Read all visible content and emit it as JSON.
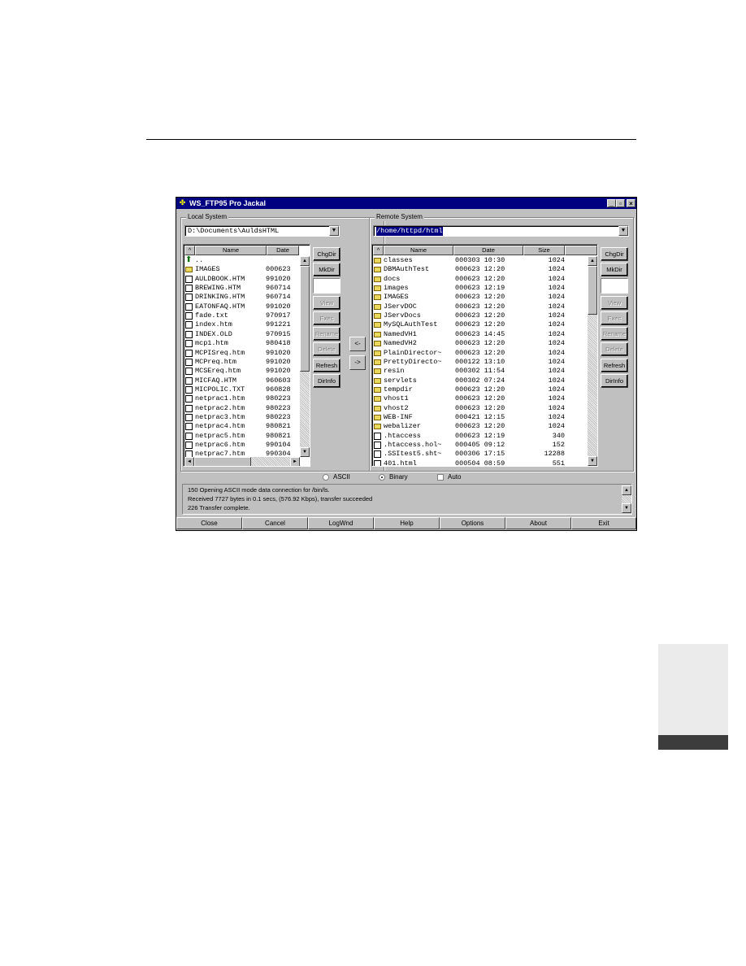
{
  "window": {
    "title": "WS_FTP95 Pro Jackal",
    "controls": [
      "_",
      "▫",
      "×"
    ]
  },
  "local": {
    "label": "Local System",
    "path": "D:\\Documents\\AuldsHTML",
    "headers": {
      "sort": "^",
      "name": "Name",
      "date": "Date"
    },
    "files": [
      {
        "name": "..",
        "date": "",
        "icon": "up-arrow-icon"
      },
      {
        "name": "IMAGES",
        "date": "000623",
        "icon": "folder-icon"
      },
      {
        "name": "AULDBOOK.HTM",
        "date": "991020",
        "icon": "file-icon"
      },
      {
        "name": "BREWING.HTM",
        "date": "960714",
        "icon": "file-icon"
      },
      {
        "name": "DRINKING.HTM",
        "date": "960714",
        "icon": "file-icon"
      },
      {
        "name": "EATONFAQ.HTM",
        "date": "991020",
        "icon": "file-icon"
      },
      {
        "name": "fade.txt",
        "date": "970917",
        "icon": "file-icon"
      },
      {
        "name": "index.htm",
        "date": "991221",
        "icon": "file-icon"
      },
      {
        "name": "INDEX.OLD",
        "date": "970915",
        "icon": "file-icon"
      },
      {
        "name": "mcp1.htm",
        "date": "980418",
        "icon": "file-icon"
      },
      {
        "name": "MCPISreq.htm",
        "date": "991020",
        "icon": "file-icon"
      },
      {
        "name": "MCPreq.htm",
        "date": "991020",
        "icon": "file-icon"
      },
      {
        "name": "MCSEreq.htm",
        "date": "991020",
        "icon": "file-icon"
      },
      {
        "name": "MICFAQ.HTM",
        "date": "960603",
        "icon": "file-icon"
      },
      {
        "name": "MICPOLIC.TXT",
        "date": "960828",
        "icon": "file-icon"
      },
      {
        "name": "netprac1.htm",
        "date": "980223",
        "icon": "file-icon"
      },
      {
        "name": "netprac2.htm",
        "date": "980223",
        "icon": "file-icon"
      },
      {
        "name": "netprac3.htm",
        "date": "980223",
        "icon": "file-icon"
      },
      {
        "name": "netprac4.htm",
        "date": "980821",
        "icon": "file-icon"
      },
      {
        "name": "netprac5.htm",
        "date": "980821",
        "icon": "file-icon"
      },
      {
        "name": "netprac6.htm",
        "date": "990104",
        "icon": "file-icon"
      },
      {
        "name": "netprac7.htm",
        "date": "990304",
        "icon": "file-icon"
      }
    ],
    "buttons": {
      "chgdir": "ChgDir",
      "mkdir": "MkDir",
      "view": "View",
      "exec": "Exec",
      "rename": "Rename",
      "delete": "Delete",
      "refresh": "Refresh",
      "dirinfo": "DirInfo"
    }
  },
  "remote": {
    "label": "Remote System",
    "path": "/home/httpd/html",
    "headers": {
      "sort": "^",
      "name": "Name",
      "date": "Date",
      "size": "Size"
    },
    "files": [
      {
        "name": "classes",
        "date": "000303 10:30",
        "size": "1024",
        "icon": "folder-icon"
      },
      {
        "name": "DBMAuthTest",
        "date": "000623 12:20",
        "size": "1024",
        "icon": "folder-icon"
      },
      {
        "name": "docs",
        "date": "000623 12:20",
        "size": "1024",
        "icon": "folder-icon"
      },
      {
        "name": "images",
        "date": "000623 12:19",
        "size": "1024",
        "icon": "folder-icon"
      },
      {
        "name": "IMAGES",
        "date": "000623 12:20",
        "size": "1024",
        "icon": "folder-icon"
      },
      {
        "name": "JServDOC",
        "date": "000623 12:20",
        "size": "1024",
        "icon": "folder-icon"
      },
      {
        "name": "JServDocs",
        "date": "000623 12:20",
        "size": "1024",
        "icon": "folder-icon"
      },
      {
        "name": "MySQLAuthTest",
        "date": "000623 12:20",
        "size": "1024",
        "icon": "folder-icon"
      },
      {
        "name": "NamedVH1",
        "date": "000623 14:45",
        "size": "1024",
        "icon": "folder-icon"
      },
      {
        "name": "NamedVH2",
        "date": "000623 12:20",
        "size": "1024",
        "icon": "folder-icon"
      },
      {
        "name": "PlainDirector~",
        "date": "000623 12:20",
        "size": "1024",
        "icon": "folder-icon"
      },
      {
        "name": "PrettyDirecto~",
        "date": "000122 13:10",
        "size": "1024",
        "icon": "folder-icon"
      },
      {
        "name": "resin",
        "date": "000302 11:54",
        "size": "1024",
        "icon": "folder-icon"
      },
      {
        "name": "servlets",
        "date": "000302 07:24",
        "size": "1024",
        "icon": "folder-icon"
      },
      {
        "name": "tempdir",
        "date": "000623 12:20",
        "size": "1024",
        "icon": "folder-icon"
      },
      {
        "name": "vhost1",
        "date": "000623 12:20",
        "size": "1024",
        "icon": "folder-icon"
      },
      {
        "name": "vhost2",
        "date": "000623 12:20",
        "size": "1024",
        "icon": "folder-icon"
      },
      {
        "name": "WEB-INF",
        "date": "000421 12:15",
        "size": "1024",
        "icon": "folder-icon"
      },
      {
        "name": "webalizer",
        "date": "000623 12:20",
        "size": "1024",
        "icon": "folder-icon"
      },
      {
        "name": ".htaccess",
        "date": "000623 12:19",
        "size": "340",
        "icon": "file-icon"
      },
      {
        "name": ".htaccess.hol~",
        "date": "000405 09:12",
        "size": "152",
        "icon": "file-icon"
      },
      {
        "name": ".SSItest5.sht~",
        "date": "000306 17:15",
        "size": "12288",
        "icon": "file-icon"
      },
      {
        "name": "401.html",
        "date": "000504 08:59",
        "size": "551",
        "icon": "file-icon"
      }
    ],
    "buttons": {
      "chgdir": "ChgDir",
      "mkdir": "MkDir",
      "view": "View",
      "exec": "Exec",
      "rename": "Rename",
      "delete": "Delete",
      "refresh": "Refresh",
      "dirinfo": "DirInfo"
    }
  },
  "transfer": {
    "to_local": "<-",
    "to_remote": "->"
  },
  "mode": {
    "ascii": "ASCII",
    "binary": "Binary",
    "auto": "Auto",
    "selected": "Binary"
  },
  "log": [
    "150 Opening ASCII mode data connection for /bin/ls.",
    "Received 7727 bytes in 0.1 secs, (576.92 Kbps), transfer succeeded",
    "226 Transfer complete."
  ],
  "bottom_buttons": [
    "Close",
    "Cancel",
    "LogWnd",
    "Help",
    "Options",
    "About",
    "Exit"
  ]
}
